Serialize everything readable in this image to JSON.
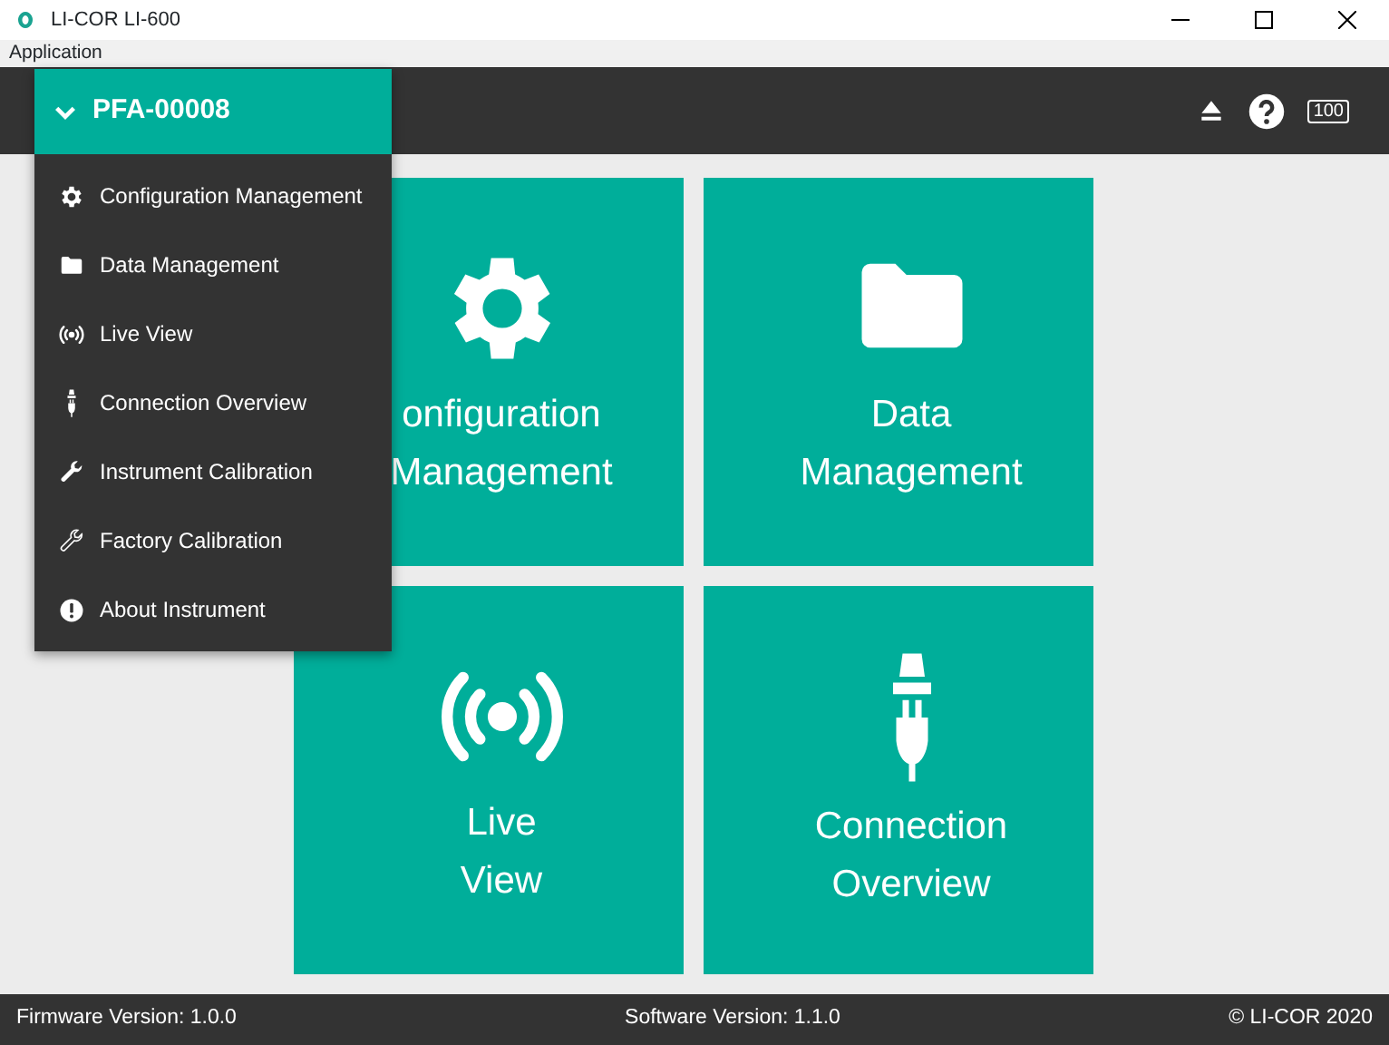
{
  "window": {
    "title": "LI-COR LI-600"
  },
  "menu_bar": [
    "Application"
  ],
  "device": {
    "name": "PFA-00008",
    "expanded": true
  },
  "battery": "100",
  "menu": [
    {
      "label": "Configuration Management"
    },
    {
      "label": "Data Management"
    },
    {
      "label": "Live View"
    },
    {
      "label": "Connection Overview"
    },
    {
      "label": "Instrument Calibration"
    },
    {
      "label": "Factory Calibration"
    },
    {
      "label": "About Instrument"
    }
  ],
  "tiles": [
    {
      "lines": [
        "onfiguration",
        "Management"
      ]
    },
    {
      "lines": [
        "Data",
        "Management"
      ]
    },
    {
      "lines": [
        "Live",
        "View"
      ]
    },
    {
      "lines": [
        "Connection",
        "Overview"
      ]
    }
  ],
  "status_bar": {
    "firmware": "Firmware Version: 1.0.0",
    "software": "Software Version: 1.1.0",
    "copyright": "© LI-COR 2020"
  }
}
